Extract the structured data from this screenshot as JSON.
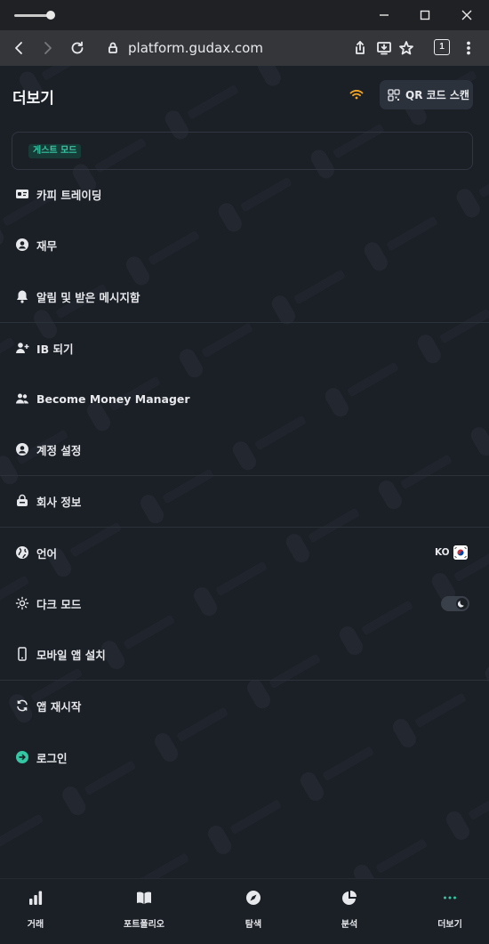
{
  "browser": {
    "url": "platform.gudax.com",
    "tab_count": "1"
  },
  "header": {
    "title": "더보기",
    "qr_button_label": "QR 코드 스캔"
  },
  "guest": {
    "badge": "게스트 모드"
  },
  "menu": {
    "copy_trading": "카피 트레이딩",
    "finance": "재무",
    "notifications": "알림 및 받은 메시지함",
    "become_ib": "IB 되기",
    "become_money_manager": "Become Money Manager",
    "account_settings": "계정 설정",
    "company_info": "회사 정보",
    "language": "언어",
    "language_code": "KO",
    "dark_mode": "다크 모드",
    "install_mobile_app": "모바일 앱 설치",
    "restart_app": "앱 재시작",
    "login": "로그인"
  },
  "bottom_nav": {
    "trade": "거래",
    "portfolio": "포트폴리오",
    "explore": "탐색",
    "analysis": "분석",
    "more": "더보기"
  },
  "colors": {
    "background": "#1b1f26",
    "accent": "#35c6a3",
    "wifi": "#f5a623"
  }
}
